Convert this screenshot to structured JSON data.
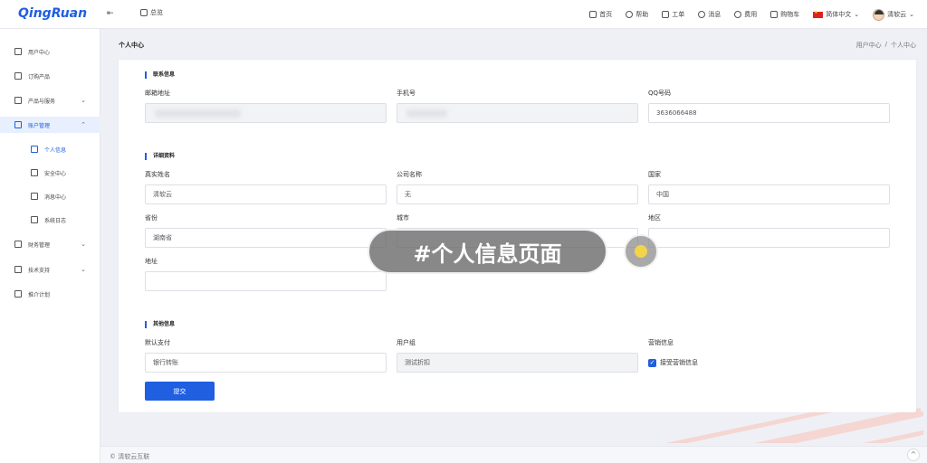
{
  "app": {
    "logo": "QingRuan",
    "collapse_icon": "menu-fold-icon"
  },
  "topbar": {
    "overview": "总览",
    "nav": [
      {
        "label": "首页",
        "icon": "home-icon"
      },
      {
        "label": "帮助",
        "icon": "help-icon"
      },
      {
        "label": "工单",
        "icon": "ticket-icon"
      },
      {
        "label": "消息",
        "icon": "bell-icon"
      },
      {
        "label": "费用",
        "icon": "cost-icon"
      },
      {
        "label": "购物车",
        "icon": "cart-icon"
      }
    ],
    "language": "简体中文",
    "user": "清软云"
  },
  "sidebar": {
    "items": [
      {
        "label": "用户中心",
        "icon": "grid-icon"
      },
      {
        "label": "订购产品",
        "icon": "cart-icon"
      },
      {
        "label": "产品与服务",
        "icon": "apps-icon",
        "chevron": "⌄"
      },
      {
        "label": "账户管理",
        "icon": "user-icon",
        "chevron": "⌃"
      },
      {
        "label": "个人信息",
        "icon": "gear-icon"
      },
      {
        "label": "安全中心",
        "icon": "shield-icon"
      },
      {
        "label": "消息中心",
        "icon": "bell-icon"
      },
      {
        "label": "系统日志",
        "icon": "log-icon"
      },
      {
        "label": "财务管理",
        "icon": "finance-icon",
        "chevron": "⌄"
      },
      {
        "label": "技术支持",
        "icon": "support-icon",
        "chevron": "⌄"
      },
      {
        "label": "推介计划",
        "icon": "send-icon"
      }
    ]
  },
  "header": {
    "title": "个人中心",
    "breadcrumb": [
      "用户中心",
      "/",
      "个人中心"
    ]
  },
  "form": {
    "contact": {
      "title": "联系信息",
      "email_label": "邮箱地址",
      "phone_label": "手机号",
      "qq_label": "QQ号码",
      "qq_value": "3636066488"
    },
    "details": {
      "title": "详细资料",
      "name_label": "真实姓名",
      "name_value": "清软云",
      "company_label": "公司名称",
      "company_value": "无",
      "country_label": "国家",
      "country_value": "中国",
      "province_label": "省份",
      "province_value": "湖南省",
      "city_label": "城市",
      "city_value": "",
      "district_label": "地区",
      "district_value": "",
      "address_label": "地址",
      "address_value": ""
    },
    "other": {
      "title": "其他信息",
      "payment_label": "默认支付",
      "payment_value": "银行转账",
      "group_label": "用户组",
      "group_value": "测试折扣",
      "marketing_label": "营销信息",
      "marketing_checkbox": "接受营销信息"
    },
    "submit": "提交"
  },
  "overlay": {
    "banner": "#个人信息页面"
  },
  "footer": {
    "text": "© 清软云互联",
    "back_top": "^"
  }
}
